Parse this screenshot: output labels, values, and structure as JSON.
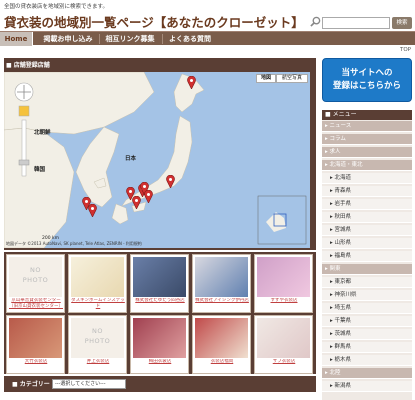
{
  "header": {
    "tagline": "全国の貸衣装店を地域別に検索できます。",
    "title": "貸衣装の地域別一覧ページ【あなたのクローゼット】",
    "search_button": "検索"
  },
  "nav": {
    "home": "Home",
    "apply": "掲載お申し込み",
    "links": "相互リンク募集",
    "faq": "よくある質問"
  },
  "top_link": "TOP",
  "map_section": {
    "title": "店舗登録店舗",
    "btn_map": "地図",
    "btn_sat": "航空写真",
    "label_korea": "韓国",
    "label_north_korea": "北朝鮮",
    "label_japan": "日本",
    "footer": "地図データ ©2013 AutoNavi, SK planet, Tele Atlas, ZENRIN - 利用規約",
    "scale": "200 km"
  },
  "shops": [
    {
      "caption": "京山華音貸衣装センター（旧京山貸衣装センター）",
      "nophoto": true
    },
    {
      "caption": "ダスキンホームインステッド",
      "nophoto": false
    },
    {
      "caption": "株式会社たゆたう四谷店",
      "nophoto": false
    },
    {
      "caption": "株式会社アイシンク伊丹店",
      "nophoto": false
    },
    {
      "caption": "すずや衣装店",
      "nophoto": false
    },
    {
      "caption": "大竹衣装店",
      "nophoto": false
    },
    {
      "caption": "井上衣装店",
      "nophoto": true
    },
    {
      "caption": "梅田衣裳店",
      "nophoto": false
    },
    {
      "caption": "衣装店福岡",
      "nophoto": false
    },
    {
      "caption": "サブ衣装店",
      "nophoto": false
    }
  ],
  "category": {
    "label": "カテゴリー",
    "select_value": "---選択してください---"
  },
  "register": {
    "line1": "当サイトへの",
    "line2": "登録はこちらから"
  },
  "menu": {
    "title": "メニュー",
    "items": [
      {
        "label": "ニュース",
        "type": "cat"
      },
      {
        "label": "コラム",
        "type": "cat"
      },
      {
        "label": "求人",
        "type": "cat"
      },
      {
        "label": "北海道・東北",
        "type": "cat"
      },
      {
        "label": "北海道",
        "type": "sub"
      },
      {
        "label": "青森県",
        "type": "sub"
      },
      {
        "label": "岩手県",
        "type": "sub"
      },
      {
        "label": "秋田県",
        "type": "sub"
      },
      {
        "label": "宮城県",
        "type": "sub"
      },
      {
        "label": "山形県",
        "type": "sub"
      },
      {
        "label": "福島県",
        "type": "sub"
      },
      {
        "label": "関東",
        "type": "cat"
      },
      {
        "label": "東京都",
        "type": "sub"
      },
      {
        "label": "神奈川県",
        "type": "sub"
      },
      {
        "label": "埼玉県",
        "type": "sub"
      },
      {
        "label": "千葉県",
        "type": "sub"
      },
      {
        "label": "茨城県",
        "type": "sub"
      },
      {
        "label": "群馬県",
        "type": "sub"
      },
      {
        "label": "栃木県",
        "type": "sub"
      },
      {
        "label": "北陸",
        "type": "cat"
      },
      {
        "label": "新潟県",
        "type": "sub"
      }
    ]
  },
  "colors": {
    "brown": "#5a3e34",
    "accent": "#1e7ac8",
    "marker": "#d03030",
    "link": "#c04040"
  }
}
